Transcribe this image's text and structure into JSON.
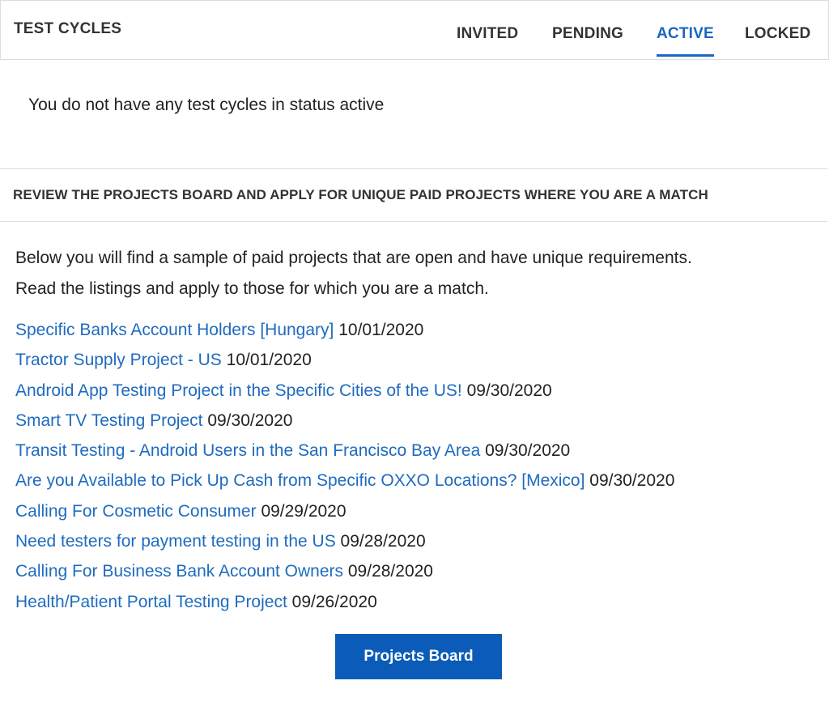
{
  "header": {
    "title": "TEST CYCLES",
    "tabs": [
      {
        "label": "INVITED"
      },
      {
        "label": "PENDING"
      },
      {
        "label": "ACTIVE"
      },
      {
        "label": "LOCKED"
      }
    ],
    "active_tab": "ACTIVE"
  },
  "empty_message": "You do not have any test cycles in status active",
  "projects_section": {
    "title": "REVIEW THE PROJECTS BOARD AND APPLY FOR UNIQUE PAID PROJECTS WHERE YOU ARE A MATCH",
    "intro_line1": "Below you will find a sample of paid projects that are open and have unique requirements.",
    "intro_line2": "Read the listings and apply to those for which you are a match.",
    "projects": [
      {
        "title": "Specific Banks Account Holders [Hungary]",
        "date": "10/01/2020"
      },
      {
        "title": "Tractor Supply Project - US",
        "date": "10/01/2020"
      },
      {
        "title": "Android App Testing Project in the Specific Cities of the US!",
        "date": "09/30/2020"
      },
      {
        "title": "Smart TV Testing Project",
        "date": "09/30/2020"
      },
      {
        "title": "Transit Testing - Android Users in the San Francisco Bay Area",
        "date": "09/30/2020"
      },
      {
        "title": "Are you Available to Pick Up Cash from Specific OXXO Locations? [Mexico]",
        "date": "09/30/2020"
      },
      {
        "title": "Calling For Cosmetic Consumer",
        "date": "09/29/2020"
      },
      {
        "title": "Need testers for payment testing in the US",
        "date": "09/28/2020"
      },
      {
        "title": "Calling For Business Bank Account Owners",
        "date": "09/28/2020"
      },
      {
        "title": "Health/Patient Portal Testing Project",
        "date": "09/26/2020"
      }
    ],
    "button_label": "Projects Board"
  },
  "colors": {
    "accent": "#1a66c2",
    "link": "#1f6bbf",
    "button": "#0a5cb8",
    "border": "#d9dde2"
  }
}
